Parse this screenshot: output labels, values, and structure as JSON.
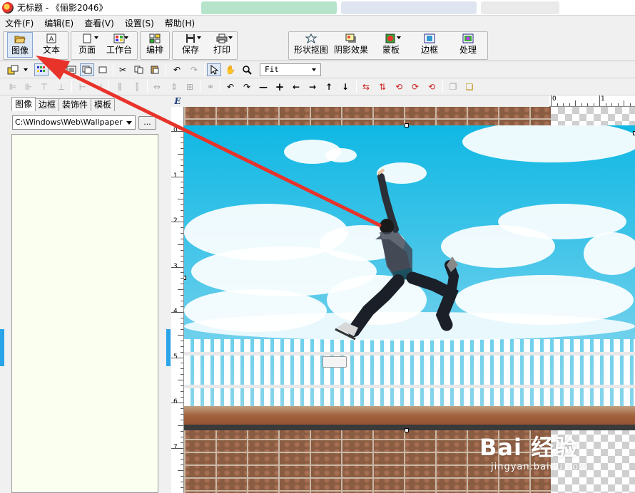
{
  "window": {
    "title": "无标题 - 《俪影2046》"
  },
  "menu": [
    "文件(F)",
    "编辑(E)",
    "查看(V)",
    "设置(S)",
    "帮助(H)"
  ],
  "toolbar": {
    "image": "图像",
    "text": "文本",
    "page": "页面",
    "workbench": "工作台",
    "layout": "编排",
    "save": "保存",
    "print": "打印",
    "shape_frame": "形状抠图",
    "shadow": "阴影效果",
    "mask": "蒙板",
    "border": "边框",
    "process": "处理"
  },
  "zoom": "Fit",
  "left_panel": {
    "tabs": [
      "图像",
      "边框",
      "装饰件",
      "模板"
    ],
    "active_tab": 0,
    "path": "C:\\Windows\\Web\\Wallpaper",
    "browse_label": "..."
  },
  "ruler": {
    "corner": "E",
    "vertical_labels": [
      "0",
      "1",
      "2",
      "3",
      "4",
      "5",
      "6",
      "7"
    ],
    "top_labels": [
      "0",
      "1"
    ]
  },
  "watermark": {
    "main": "Bai 经验",
    "sub": "jingyan.baidu.com"
  },
  "colors": {
    "annotation_arrow": "#e8332a",
    "splitter": "#2aa4e8"
  }
}
